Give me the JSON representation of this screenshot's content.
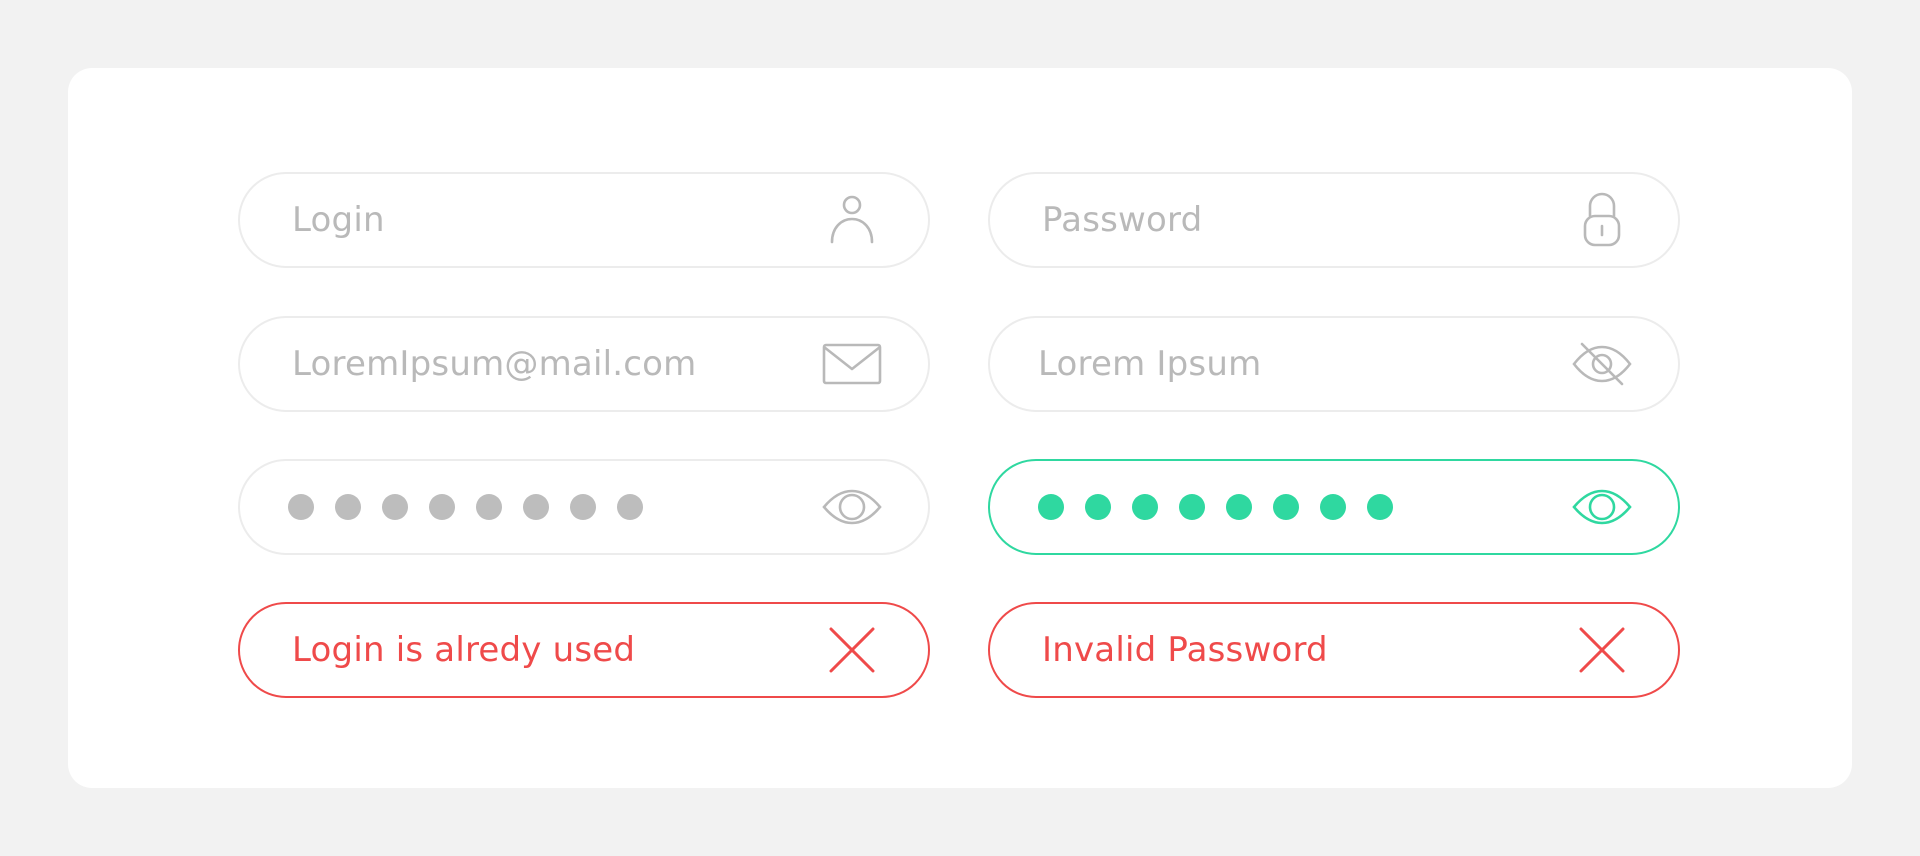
{
  "form": {
    "login_field": {
      "placeholder": "Login",
      "icon": "user-icon"
    },
    "password_field": {
      "placeholder": "Password",
      "icon": "lock-icon"
    },
    "email_field": {
      "value": "LoremIpsum@mail.com",
      "icon": "envelope-icon"
    },
    "revealed_password_field": {
      "value": "Lorem Ipsum",
      "icon": "eye-slash-icon"
    },
    "masked_password_field": {
      "mask_length": 8,
      "icon": "eye-icon"
    },
    "active_password_field": {
      "mask_length": 8,
      "icon": "eye-icon"
    },
    "login_error": {
      "message": "Login is alredy used",
      "icon": "close-icon"
    },
    "password_error": {
      "message": "Invalid Password",
      "icon": "close-icon"
    }
  },
  "colors": {
    "page_background": "#f2f2f2",
    "card_background": "#ffffff",
    "field_border": "#ececec",
    "placeholder_text": "#b9b9b9",
    "icon_gray": "#b9b9b9",
    "active_accent": "#2fd8a0",
    "error": "#ef4a4a"
  }
}
